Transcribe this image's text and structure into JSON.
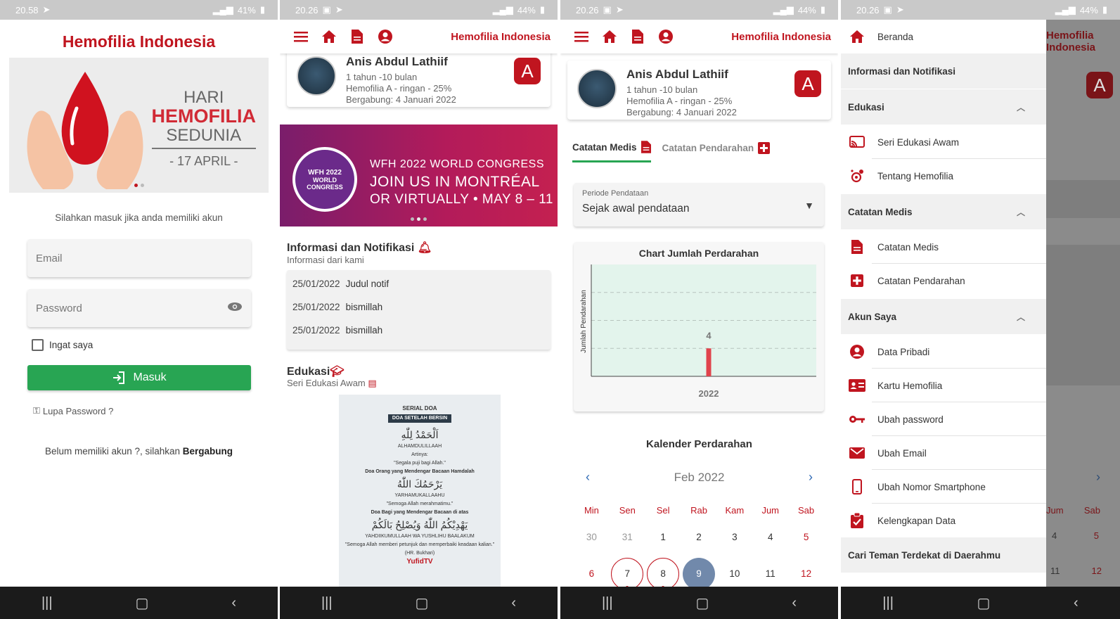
{
  "panel1": {
    "status": {
      "time": "20.58",
      "battery": "41%"
    },
    "app_title": "Hemofilia Indonesia",
    "banner": {
      "line1": "HARI",
      "line2": "HEMOFILIA",
      "line3": "SEDUNIA",
      "line4": "- 17 APRIL -"
    },
    "prompt": "Silahkan masuk jika anda memiliki akun",
    "email_placeholder": "Email",
    "password_placeholder": "Password",
    "remember_label": "Ingat saya",
    "login_label": "Masuk",
    "forgot_label": "Lupa Password ?",
    "join_text": "Belum memiliki akun ?, silahkan ",
    "join_link": "Bergabung"
  },
  "common": {
    "status_time": "20.26",
    "status_battery": "44%",
    "app_title": "Hemofilia Indonesia",
    "profile": {
      "name": "Anis Abdul Lathiif",
      "age": "1 tahun -10 bulan",
      "type": "Hemofilia A - ringan - 25%",
      "joined": "Bergabung: 4 Januari 2022",
      "badge": "A"
    }
  },
  "panel2": {
    "wfh": {
      "logo_line1": "WFH 2022",
      "logo_line2": "WORLD",
      "logo_line3": "CONGRESS",
      "t1": "WFH 2022 WORLD CONGRESS",
      "t2": "JOIN US IN MONTRÉAL",
      "t3": "OR VIRTUALLY  •  MAY 8 – 11"
    },
    "info_title": "Informasi dan Notifikasi",
    "info_sub": "Informasi dari kami",
    "notifications": [
      {
        "date": "25/01/2022",
        "text": "Judul notif"
      },
      {
        "date": "25/01/2022",
        "text": "bismillah"
      },
      {
        "date": "25/01/2022",
        "text": "bismillah"
      }
    ],
    "edu_title": "Edukasi",
    "edu_sub": "Seri Edukasi Awam",
    "doa": {
      "series": "SERIAL DOA",
      "heading": "DOA SETELAH BERSIN",
      "arabic1": "اَلْحَمْدُ لِلّٰهِ",
      "latin1": "ALHAMDULILLAAH",
      "meaning_label": "Artinya:",
      "meaning1": "\"Segala puji bagi Allah.\"",
      "sub2": "Doa Orang yang Mendengar Bacaan Hamdalah",
      "arabic2": "يَرْحَمُكَ اللّٰهُ",
      "latin2": "YARHAMUKALLAAHU",
      "meaning2": "\"Semoga Allah merahmatimu.\"",
      "sub3": "Doa Bagi yang Mendengar Bacaan di atas",
      "arabic3": "يَهْدِيْكُمُ اللّٰهُ وَيُصْلِحُ بَالَكُمْ",
      "latin3": "YAHDIIKUMULLAAH WA YUSHLIHU BAALAKUM",
      "meaning3": "\"Semoga Allah memberi petunjuk dan memperbaiki keadaan kalian.\"",
      "source": "(HR. Bukhari)",
      "brand": "YufidTV"
    }
  },
  "panel3": {
    "tab1": "Catatan Medis",
    "tab2": "Catatan Pendarahan",
    "period_label": "Periode Pendataan",
    "period_value": "Sejak awal pendataan",
    "calendar_title": "Kalender Perdarahan",
    "calendar_month": "Feb 2022",
    "weekdays": [
      "Min",
      "Sen",
      "Sel",
      "Rab",
      "Kam",
      "Jum",
      "Sab"
    ],
    "week1": [
      "30",
      "31",
      "1",
      "2",
      "3",
      "4",
      "5"
    ],
    "week2": [
      "6",
      "7",
      "8",
      "9",
      "10",
      "11",
      "12"
    ]
  },
  "chart_data": {
    "type": "bar",
    "title": "Chart Jumlah Perdarahan",
    "ylabel": "Jumlah Pendarahan",
    "xlabel": "",
    "categories": [
      "2022"
    ],
    "values": [
      4
    ],
    "ylim": [
      0,
      16
    ],
    "grid": true,
    "color": "#e0434c"
  },
  "panel4": {
    "items": {
      "beranda": "Beranda",
      "info": "Informasi dan Notifikasi",
      "edukasi": "Edukasi",
      "seri": "Seri Edukasi Awam",
      "tentang": "Tentang Hemofilia",
      "catatan_medis_sec": "Catatan Medis",
      "catatan_medis": "Catatan Medis",
      "catatan_pendarahan": "Catatan Pendarahan",
      "akun_sec": "Akun Saya",
      "data_pribadi": "Data Pribadi",
      "kartu": "Kartu Hemofilia",
      "ubah_password": "Ubah password",
      "ubah_email": "Ubah Email",
      "ubah_nomor": "Ubah Nomor Smartphone",
      "kelengkapan": "Kelengkapan Data",
      "cari": "Cari Teman Terdekat di Daerahmu"
    },
    "backdrop": {
      "title": "Hemofilia Indonesia",
      "badge": "A",
      "wk_jum": "Jum",
      "wk_sab": "Sab",
      "d4": "4",
      "d5": "5",
      "d11": "11",
      "d12": "12"
    }
  },
  "colors": {
    "brand_red": "#c0151f",
    "green": "#28a553",
    "chart_bg": "#e3f4ec",
    "calendar_selected": "#7189ab"
  }
}
